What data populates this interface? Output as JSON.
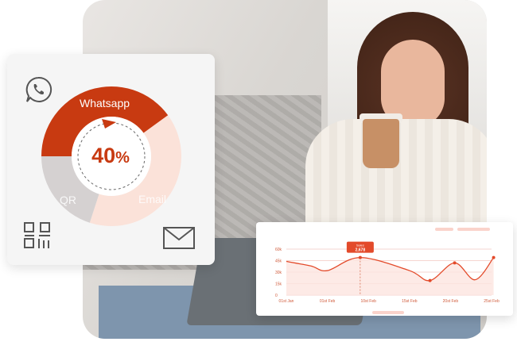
{
  "donut_card": {
    "center_value": "40",
    "center_unit": "%",
    "segments": [
      {
        "label": "Whatsapp",
        "value": 40,
        "color": "#c83a11"
      },
      {
        "label": "Email",
        "value": 40,
        "color": "#fbe2d9"
      },
      {
        "label": "QR",
        "value": 20,
        "color": "#d5d1d1"
      }
    ]
  },
  "colors": {
    "accent": "#c83a11",
    "accent_line": "#e34a2a",
    "light_fill": "#fde5e0"
  },
  "chart_data": {
    "type": "area",
    "categories": [
      "01st Jan",
      "01st Feb",
      "10st Feb",
      "15st Feb",
      "20st Feb",
      "25st Feb"
    ],
    "y_ticks": [
      "0",
      "15k",
      "30k",
      "45k",
      "60k"
    ],
    "ylim": [
      0,
      60
    ],
    "series": [
      {
        "values": [
          44,
          38,
          32,
          49,
          32,
          19,
          42,
          20,
          49
        ]
      }
    ],
    "x_positions": [
      0,
      0.6,
      1,
      1.8,
      3,
      3.5,
      4.1,
      4.6,
      5.05
    ],
    "tooltip": {
      "label": "Sales",
      "value": "2,678"
    }
  }
}
